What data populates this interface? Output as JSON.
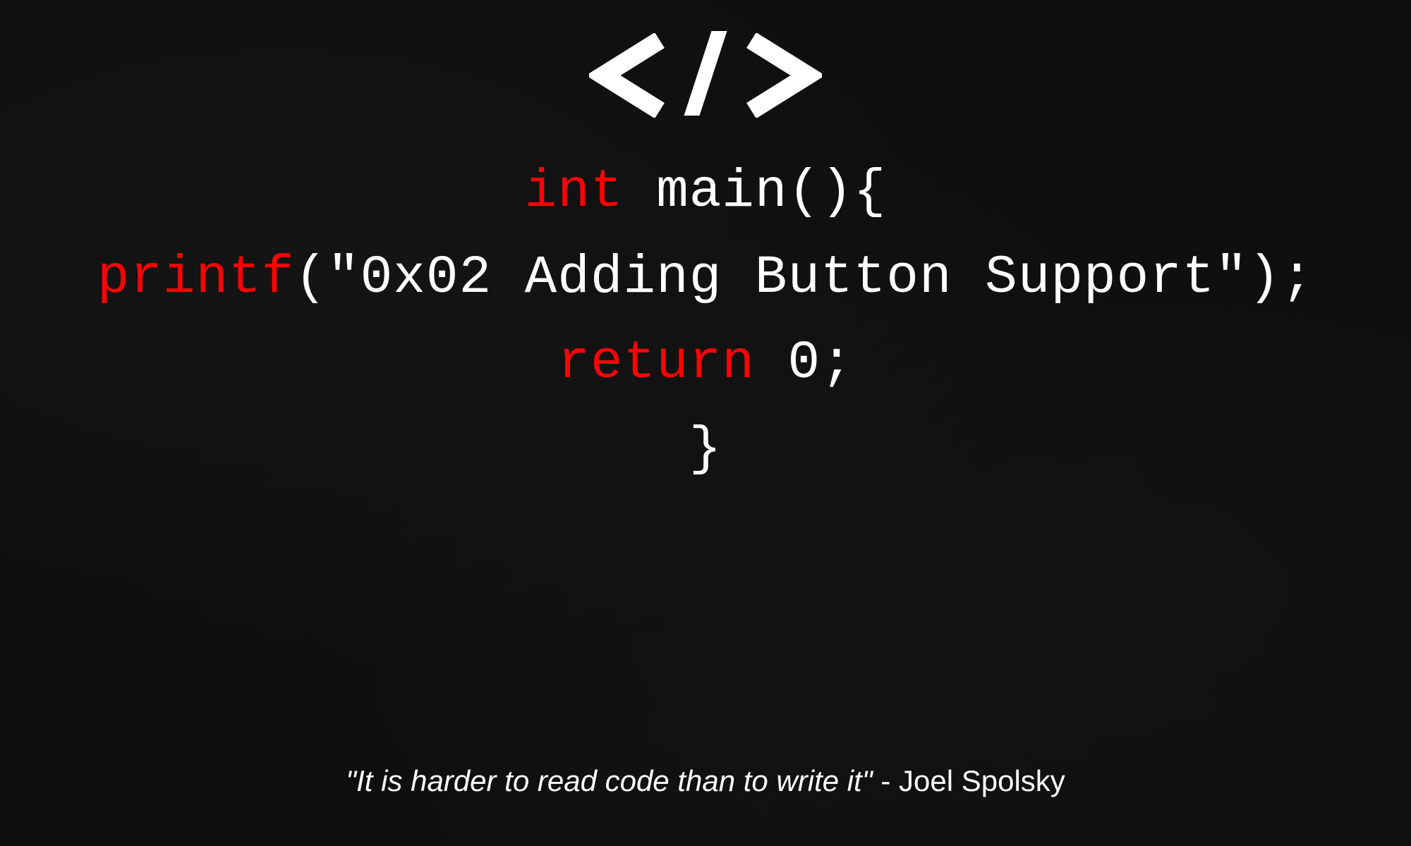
{
  "logo": {
    "name": "code-tag-icon"
  },
  "code": {
    "line1_keyword": "int",
    "line1_rest": " main(){",
    "line2_keyword": "printf",
    "line2_rest": "(\"0x02 Adding Button Support\");",
    "line3_keyword": "return",
    "line3_rest": " 0;",
    "line4": "}"
  },
  "quote": {
    "text": "\"It is harder to read code than to write it\"",
    "separator": " - ",
    "author": "Joel Spolsky"
  },
  "colors": {
    "background": "#0e0e0e",
    "keyword": "#f70506",
    "text": "#ffffff"
  }
}
